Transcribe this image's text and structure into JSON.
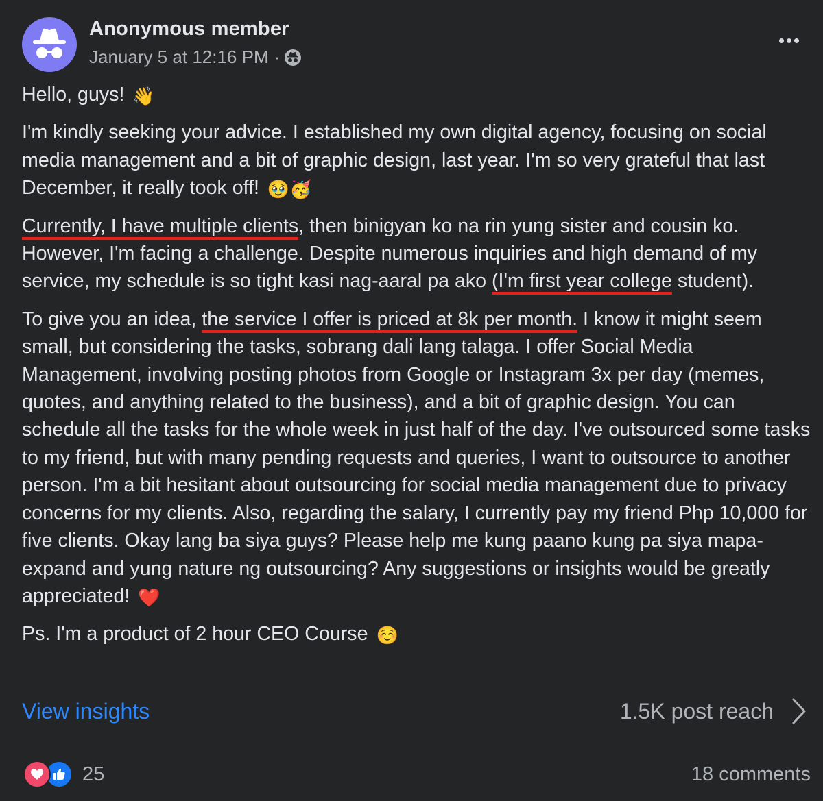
{
  "header": {
    "author": "Anonymous member",
    "timestamp": "January 5 at 12:16 PM",
    "separator": "·",
    "avatar_icon": "incognito-icon",
    "audience_icon": "anonymous-audience-icon",
    "more_icon": "more-options-icon"
  },
  "body": {
    "greeting": "Hello, guys!",
    "greeting_emoji": "👋",
    "p1": "I'm kindly seeking your advice. I established my own digital agency, focusing on social media management and a bit of graphic design, last year. I'm so very grateful that last December, it really took off!",
    "p1_emoji": "🥹🥳",
    "p2_highlight_1": "Currently, I have multiple clients",
    "p2_mid": ", then binigyan ko na rin yung sister and cousin ko. However, I'm facing a challenge. Despite numerous inquiries and high demand of my service, my schedule is so tight kasi nag-aaral pa ako ",
    "p2_highlight_2": "(I'm first year college",
    "p2_end": " student).",
    "p3_start": "To give you an idea, ",
    "p3_highlight": "the service I offer is priced at 8k per month.",
    "p3_rest": " I know it might seem small, but considering the tasks, sobrang dali lang talaga. I offer Social Media Management, involving posting photos from Google or Instagram 3x per day (memes, quotes, and anything related to the business), and a bit of graphic design. You can schedule all the tasks for the whole week in just half of the day. I've outsourced some tasks to my friend, but with many pending requests and queries, I want to outsource to another person. I'm a bit hesitant about outsourcing for social media management due to privacy concerns for my clients. Also, regarding the salary, I currently pay my friend Php 10,000 for five clients. Okay lang ba siya guys? Please help me kung paano kung pa siya mapa-expand and yung nature ng outsourcing? Any suggestions or insights would be greatly appreciated!",
    "p3_emoji": "❤️",
    "ps": "Ps. I'm a product of 2 hour CEO Course",
    "ps_emoji": "☺️"
  },
  "insights": {
    "link_label": "View insights",
    "reach_label": "1.5K post reach"
  },
  "footer": {
    "reaction_count": "25",
    "comments_label": "18 comments",
    "reaction_icons": [
      "love-icon",
      "like-icon"
    ]
  },
  "colors": {
    "background": "#242526",
    "text": "#e4e6eb",
    "muted": "#b0b3b8",
    "link": "#2d88ff",
    "highlight_underline": "#e8201a",
    "avatar_bg": "#7f7cf3"
  }
}
